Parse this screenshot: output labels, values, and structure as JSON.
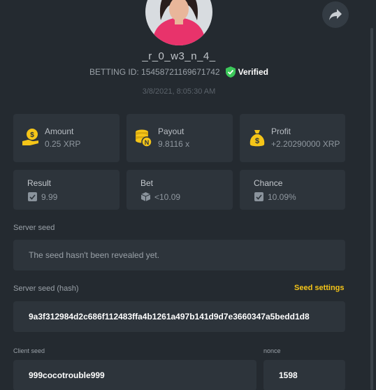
{
  "profile": {
    "username": "_r_0_w3_n_4_",
    "betting_id": "BETTING ID: 15458721169671742",
    "verified_label": "Verified",
    "date": "3/8/2021, 8:05:30 AM"
  },
  "stats": [
    {
      "label": "Amount",
      "value": "0.25 XRP",
      "icon": "coin-hand-icon"
    },
    {
      "label": "Payout",
      "value": "9.8116 x",
      "icon": "coin-stack-icon"
    },
    {
      "label": "Profit",
      "value": "+2.20290000 XRP",
      "icon": "money-bag-icon"
    }
  ],
  "details": [
    {
      "label": "Result",
      "value": "9.99"
    },
    {
      "label": "Bet",
      "value": "<10.09"
    },
    {
      "label": "Chance",
      "value": "10.09%"
    }
  ],
  "server_seed": {
    "label": "Server seed",
    "value": "The seed hasn't been revealed yet."
  },
  "server_seed_hash": {
    "label": "Server seed (hash)",
    "settings_label": "Seed settings",
    "value": "9a3f312984d2c686f112483ffa4b1261a497b141d9d7e3660347a5bedd1d8"
  },
  "client_seed": {
    "label": "Client seed",
    "value": "999cocotrouble999"
  },
  "nonce": {
    "label": "nonce",
    "value": "1598"
  },
  "colors": {
    "background": "#242a30",
    "card": "#2d343b",
    "accent": "#f5c518",
    "verified": "#3cc85a"
  }
}
